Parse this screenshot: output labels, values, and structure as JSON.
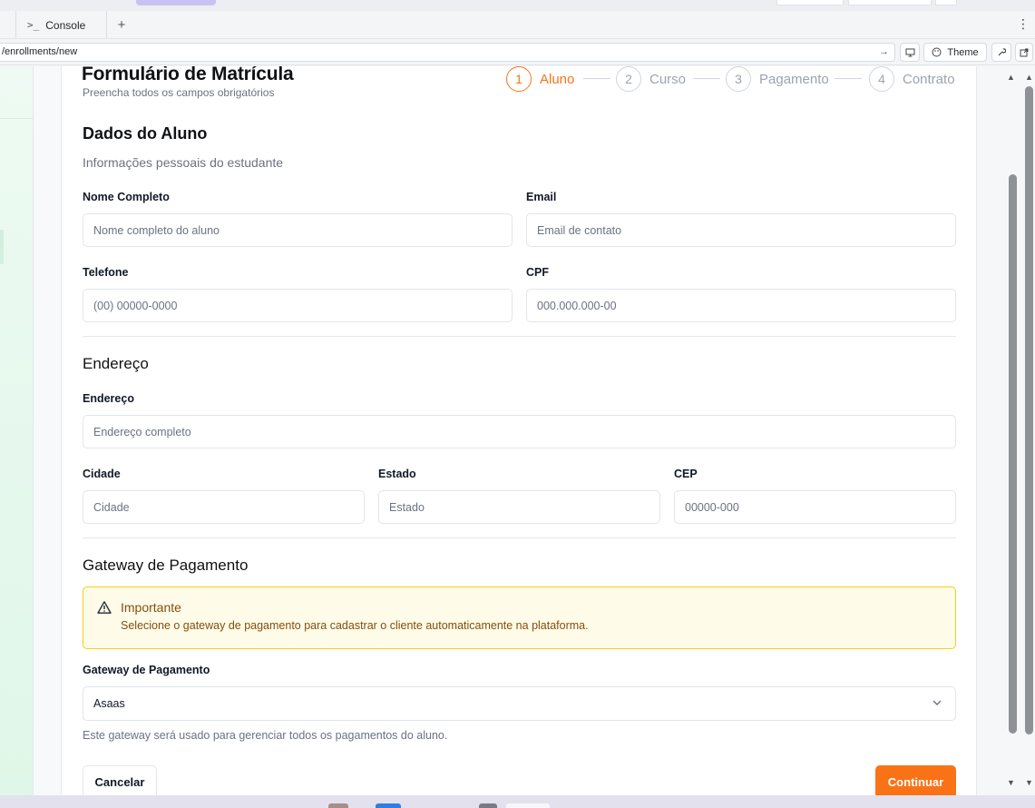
{
  "browser": {
    "tabs": [
      {
        "label": "Console"
      }
    ],
    "add_tab": "+",
    "url": "/enrollments/new",
    "theme_label": "Theme"
  },
  "form": {
    "title": "Formulário de Matrícula",
    "subtitle": "Preencha todos os campos obrigatórios",
    "steps": [
      {
        "number": "1",
        "label": "Aluno",
        "active": true
      },
      {
        "number": "2",
        "label": "Curso",
        "active": false
      },
      {
        "number": "3",
        "label": "Pagamento",
        "active": false
      },
      {
        "number": "4",
        "label": "Contrato",
        "active": false
      }
    ],
    "student": {
      "title": "Dados do Aluno",
      "subtitle": "Informações pessoais do estudante",
      "name_label": "Nome Completo",
      "name_placeholder": "Nome completo do aluno",
      "email_label": "Email",
      "email_placeholder": "Email de contato",
      "phone_label": "Telefone",
      "phone_placeholder": "(00) 00000-0000",
      "cpf_label": "CPF",
      "cpf_placeholder": "000.000.000-00"
    },
    "address": {
      "title": "Endereço",
      "address_label": "Endereço",
      "address_placeholder": "Endereço completo",
      "city_label": "Cidade",
      "city_placeholder": "Cidade",
      "state_label": "Estado",
      "state_placeholder": "Estado",
      "zip_label": "CEP",
      "zip_placeholder": "00000-000"
    },
    "gateway": {
      "title": "Gateway de Pagamento",
      "alert_title": "Importante",
      "alert_text": "Selecione o gateway de pagamento para cadastrar o cliente automaticamente na plataforma.",
      "select_label": "Gateway de Pagamento",
      "selected": "Asaas",
      "hint": "Este gateway será usado para gerenciar todos os pagamentos do aluno."
    },
    "actions": {
      "cancel": "Cancelar",
      "continue": "Continuar"
    }
  },
  "colors": {
    "accent": "#f97316",
    "alert_bg": "#fefce8",
    "alert_border": "#facc15",
    "alert_text": "#854d0e"
  }
}
